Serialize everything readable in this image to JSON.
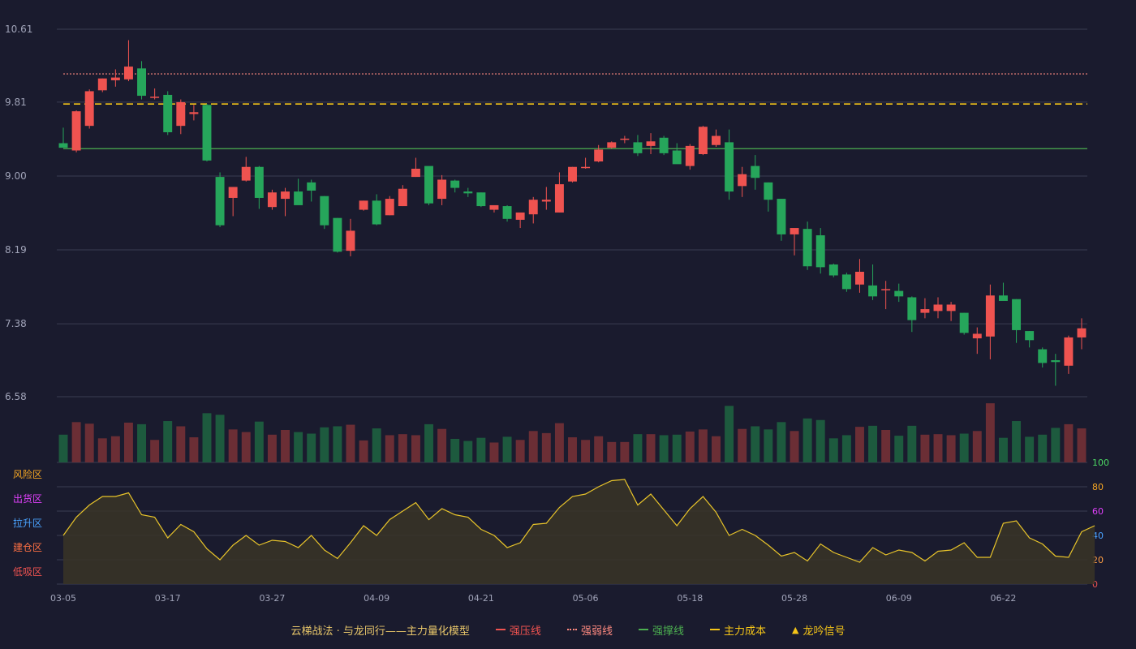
{
  "chart_data": {
    "type": "candlestick",
    "x_labels": [
      "03-05",
      "03-17",
      "03-27",
      "04-09",
      "04-21",
      "05-06",
      "05-18",
      "05-28",
      "06-09",
      "06-22"
    ],
    "y_ticks": [
      "10.61",
      "9.81",
      "9.00",
      "8.19",
      "7.38",
      "6.58"
    ],
    "y_range": [
      6.58,
      10.61
    ],
    "ref_lines": {
      "strong_pressure": 9.81,
      "weak_line": 10.12,
      "support": 9.3,
      "main_cost": 9.79
    },
    "candles": [
      [
        9.36,
        9.53,
        9.31,
        9.31
      ],
      [
        9.28,
        9.72,
        9.26,
        9.71
      ],
      [
        9.55,
        9.95,
        9.52,
        9.93
      ],
      [
        9.94,
        10.07,
        9.92,
        10.07
      ],
      [
        10.05,
        10.17,
        9.98,
        10.08
      ],
      [
        10.06,
        10.49,
        10.04,
        10.2
      ],
      [
        10.18,
        10.26,
        9.84,
        9.88
      ],
      [
        9.86,
        9.96,
        9.84,
        9.87
      ],
      [
        9.89,
        9.93,
        9.45,
        9.48
      ],
      [
        9.55,
        9.84,
        9.46,
        9.81
      ],
      [
        9.68,
        9.78,
        9.61,
        9.7
      ],
      [
        9.78,
        9.79,
        9.16,
        9.17
      ],
      [
        8.99,
        9.04,
        8.44,
        8.46
      ],
      [
        8.76,
        8.88,
        8.56,
        8.88
      ],
      [
        8.95,
        9.21,
        8.94,
        9.1
      ],
      [
        9.1,
        9.11,
        8.64,
        8.76
      ],
      [
        8.66,
        8.85,
        8.63,
        8.82
      ],
      [
        8.75,
        8.87,
        8.56,
        8.83
      ],
      [
        8.83,
        8.97,
        8.7,
        8.68
      ],
      [
        8.93,
        8.96,
        8.72,
        8.84
      ],
      [
        8.78,
        8.78,
        8.42,
        8.46
      ],
      [
        8.54,
        8.54,
        8.16,
        8.17
      ],
      [
        8.18,
        8.53,
        8.12,
        8.4
      ],
      [
        8.63,
        8.73,
        8.62,
        8.73
      ],
      [
        8.73,
        8.8,
        8.46,
        8.47
      ],
      [
        8.57,
        8.78,
        8.57,
        8.75
      ],
      [
        8.67,
        8.9,
        8.67,
        8.86
      ],
      [
        8.99,
        9.2,
        8.99,
        9.08
      ],
      [
        9.11,
        9.1,
        8.68,
        8.7
      ],
      [
        8.75,
        9.01,
        8.68,
        8.96
      ],
      [
        8.95,
        8.96,
        8.82,
        8.87
      ],
      [
        8.83,
        8.87,
        8.77,
        8.81
      ],
      [
        8.82,
        8.82,
        8.66,
        8.67
      ],
      [
        8.63,
        8.67,
        8.6,
        8.68
      ],
      [
        8.67,
        8.68,
        8.5,
        8.53
      ],
      [
        8.52,
        8.55,
        8.43,
        8.6
      ],
      [
        8.58,
        8.77,
        8.48,
        8.74
      ],
      [
        8.72,
        8.88,
        8.63,
        8.74
      ],
      [
        8.6,
        9.04,
        8.6,
        8.91
      ],
      [
        8.94,
        9.1,
        8.93,
        9.1
      ],
      [
        9.09,
        9.2,
        9.08,
        9.1
      ],
      [
        9.16,
        9.34,
        9.15,
        9.29
      ],
      [
        9.31,
        9.38,
        9.3,
        9.37
      ],
      [
        9.4,
        9.44,
        9.36,
        9.41
      ],
      [
        9.37,
        9.45,
        9.22,
        9.25
      ],
      [
        9.33,
        9.47,
        9.24,
        9.38
      ],
      [
        9.42,
        9.44,
        9.23,
        9.25
      ],
      [
        9.28,
        9.36,
        9.14,
        9.13
      ],
      [
        9.11,
        9.35,
        9.07,
        9.33
      ],
      [
        9.24,
        9.55,
        9.23,
        9.54
      ],
      [
        9.34,
        9.51,
        9.32,
        9.44
      ],
      [
        9.37,
        9.51,
        8.74,
        8.83
      ],
      [
        8.89,
        9.1,
        8.77,
        9.02
      ],
      [
        9.11,
        9.23,
        8.85,
        8.98
      ],
      [
        8.93,
        8.93,
        8.61,
        8.74
      ],
      [
        8.75,
        8.75,
        8.29,
        8.36
      ],
      [
        8.36,
        8.42,
        8.13,
        8.43
      ],
      [
        8.42,
        8.5,
        7.97,
        8.01
      ],
      [
        8.35,
        8.43,
        7.93,
        8.0
      ],
      [
        8.03,
        8.04,
        7.89,
        7.91
      ],
      [
        7.92,
        7.94,
        7.73,
        7.76
      ],
      [
        7.81,
        8.09,
        7.72,
        7.95
      ],
      [
        7.8,
        8.03,
        7.64,
        7.68
      ],
      [
        7.75,
        7.85,
        7.54,
        7.76
      ],
      [
        7.74,
        7.82,
        7.62,
        7.68
      ],
      [
        7.67,
        7.68,
        7.29,
        7.42
      ],
      [
        7.5,
        7.66,
        7.44,
        7.54
      ],
      [
        7.52,
        7.67,
        7.44,
        7.59
      ],
      [
        7.52,
        7.62,
        7.41,
        7.59
      ],
      [
        7.5,
        7.5,
        7.26,
        7.28
      ],
      [
        7.22,
        7.34,
        7.05,
        7.27
      ],
      [
        7.24,
        7.81,
        6.99,
        7.69
      ],
      [
        7.69,
        7.83,
        7.67,
        7.63
      ],
      [
        7.65,
        7.65,
        7.17,
        7.31
      ],
      [
        7.3,
        7.3,
        7.12,
        7.2
      ],
      [
        7.1,
        7.12,
        6.9,
        6.95
      ],
      [
        6.98,
        7.05,
        6.7,
        6.96
      ],
      [
        6.92,
        7.25,
        6.83,
        7.23
      ],
      [
        7.23,
        7.44,
        7.1,
        7.33
      ]
    ],
    "volume_max": 100,
    "indicator": {
      "y_ticks": [
        "100",
        "80",
        "60",
        "40",
        "20",
        "0"
      ],
      "zones": [
        "风险区",
        "出货区",
        "拉升区",
        "建仓区",
        "低吸区"
      ],
      "values": [
        40,
        55,
        65,
        72,
        72,
        75,
        57,
        55,
        38,
        49,
        43,
        29,
        20,
        32,
        40,
        32,
        36,
        35,
        30,
        40,
        28,
        21,
        34,
        48,
        40,
        53,
        60,
        67,
        53,
        62,
        57,
        55,
        45,
        40,
        30,
        34,
        49,
        50,
        63,
        72,
        74,
        80,
        85,
        86,
        65,
        74,
        61,
        48,
        62,
        72,
        59,
        40,
        45,
        40,
        32,
        23,
        26,
        19,
        33,
        26,
        22,
        18,
        30,
        24,
        28,
        26,
        19,
        27,
        28,
        34,
        22,
        22,
        50,
        52,
        38,
        33,
        23,
        22,
        43,
        48
      ]
    },
    "legend": [
      {
        "label": "云梯战法 · 与龙同行——主力量化模型"
      },
      {
        "label": "强压线",
        "color": "#ef5350"
      },
      {
        "label": "强弱线",
        "color": "#ff8a80"
      },
      {
        "label": "强撑线",
        "color": "#4caf50"
      },
      {
        "label": "主力成本",
        "color": "#f5c518"
      },
      {
        "label": "龙吟信号",
        "color": "#f5c518"
      }
    ]
  }
}
